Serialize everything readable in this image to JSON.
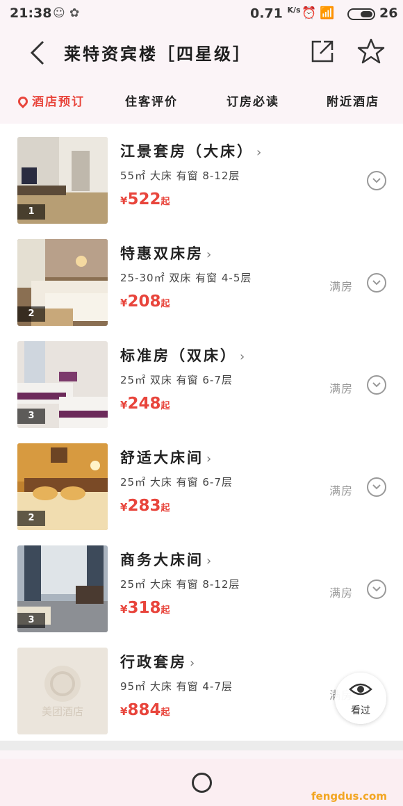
{
  "status_bar": {
    "time": "21:38",
    "speed": "0.71",
    "speed_unit": "K/s",
    "battery": "26"
  },
  "header": {
    "title": "莱特资宾楼［四星级］"
  },
  "tabs": [
    {
      "label": "酒店预订",
      "active": true
    },
    {
      "label": "住客评价",
      "active": false
    },
    {
      "label": "订房必读",
      "active": false
    },
    {
      "label": "附近酒店",
      "active": false
    }
  ],
  "rooms": [
    {
      "name": "江景套房（大床）",
      "info": "55㎡ 大床 有窗 8-12层",
      "currency": "¥",
      "price": "522",
      "suffix": "起",
      "photo_count": "1",
      "status": ""
    },
    {
      "name": "特惠双床房",
      "info": "25-30㎡ 双床 有窗 4-5层",
      "currency": "¥",
      "price": "208",
      "suffix": "起",
      "photo_count": "2",
      "status": "满房"
    },
    {
      "name": "标准房（双床）",
      "info": "25㎡ 双床 有窗 6-7层",
      "currency": "¥",
      "price": "248",
      "suffix": "起",
      "photo_count": "3",
      "status": "满房"
    },
    {
      "name": "舒适大床间",
      "info": "25㎡ 大床 有窗 6-7层",
      "currency": "¥",
      "price": "283",
      "suffix": "起",
      "photo_count": "2",
      "status": "满房"
    },
    {
      "name": "商务大床间",
      "info": "25㎡ 大床 有窗 8-12层",
      "currency": "¥",
      "price": "318",
      "suffix": "起",
      "photo_count": "3",
      "status": "满房"
    },
    {
      "name": "行政套房",
      "info": "95㎡ 大床 有窗 4-7层",
      "currency": "¥",
      "price": "884",
      "suffix": "起",
      "photo_count": "",
      "status": "满房",
      "placeholder_logo": "美团酒店"
    }
  ],
  "float_button": {
    "label": "看过"
  },
  "watermark": "fengdus.com",
  "colors": {
    "accent": "#e8453c",
    "watermark": "#f2a623"
  }
}
